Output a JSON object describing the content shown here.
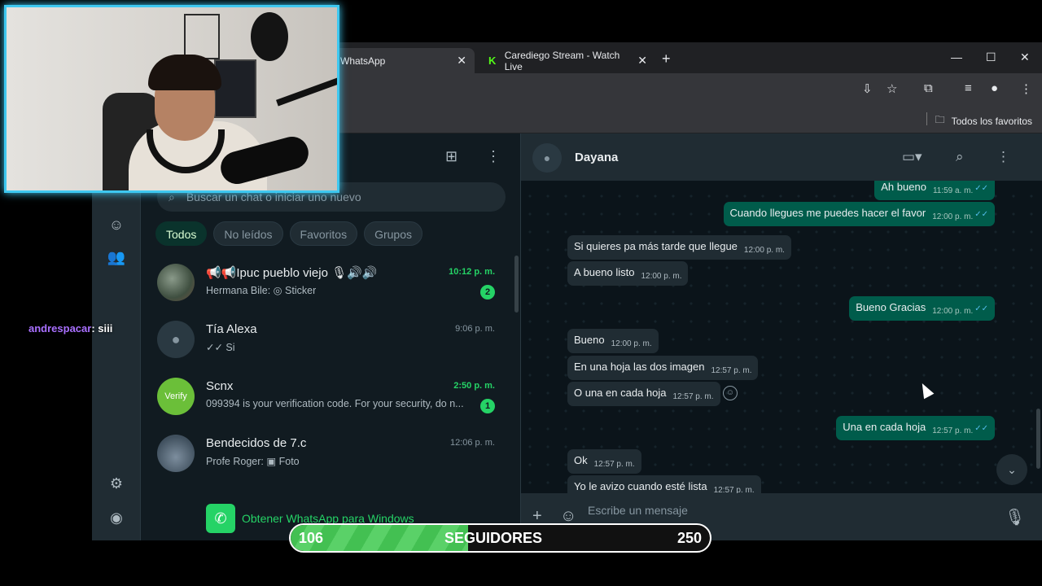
{
  "browser": {
    "tabs": [
      {
        "label": "WhatsApp",
        "active": true
      },
      {
        "label": "Carediego Stream - Watch Live",
        "active": false
      }
    ],
    "bookmarks_label": "Todos los favoritos"
  },
  "sidebar": {
    "search_placeholder": "Buscar un chat o iniciar uno nuevo",
    "filters": [
      "Todos",
      "No leídos",
      "Favoritos",
      "Grupos"
    ],
    "chats": [
      {
        "title": "📢📢Ipuc pueblo viejo 🎙🔊🔊",
        "subtitle": "Hermana Bile: ◎ Sticker",
        "time": "10:12 p. m.",
        "unread": "2"
      },
      {
        "title": "Tía Alexa",
        "subtitle": "✓✓ Si",
        "time": "9:06 p. m.",
        "unread": ""
      },
      {
        "title": "Scnx",
        "subtitle": "099394 is your verification code. For your security, do n...",
        "time": "2:50 p. m.",
        "unread": "1",
        "avatar_text": "Verify"
      },
      {
        "title": "Bendecidos de 7.c",
        "subtitle": "Profe Roger: ▣ Foto",
        "time": "12:06 p. m.",
        "unread": ""
      }
    ],
    "get_app": "Obtener WhatsApp para Windows"
  },
  "conversation": {
    "contact": "Dayana",
    "composer_placeholder": "Escribe un mensaje",
    "messages": [
      {
        "dir": "out",
        "text": "Ah bueno",
        "time": "11:59 a. m."
      },
      {
        "dir": "out",
        "text": "Cuando llegues me puedes hacer el favor",
        "time": "12:00 p. m."
      },
      {
        "dir": "in",
        "text": "Si quieres pa más tarde que llegue",
        "time": "12:00 p. m."
      },
      {
        "dir": "in",
        "text": "A bueno listo",
        "time": "12:00 p. m."
      },
      {
        "dir": "out",
        "text": "Bueno Gracias",
        "time": "12:00 p. m."
      },
      {
        "dir": "in",
        "text": "Bueno",
        "time": "12:00 p. m."
      },
      {
        "dir": "in",
        "text": "En una hoja las dos imagen",
        "time": "12:57 p. m."
      },
      {
        "dir": "in",
        "text": "O una en cada hoja",
        "time": "12:57 p. m."
      },
      {
        "dir": "out",
        "text": "Una en cada hoja",
        "time": "12:57 p. m."
      },
      {
        "dir": "in",
        "text": "Ok",
        "time": "12:57 p. m."
      },
      {
        "dir": "in",
        "text": "Yo le avizo cuando esté lista",
        "time": "12:57 p. m."
      }
    ]
  },
  "stream": {
    "chat_user": "andrespacar",
    "chat_message": ": siii",
    "followers_current": "106",
    "followers_label": "SEGUIDORES",
    "followers_goal": "250",
    "followers_progress": 0.424
  },
  "colors": {
    "accent_green": "#25d366",
    "bubble_out": "#005c4b",
    "bubble_in": "#202c33",
    "webcam_border": "#3ec8f0",
    "chat_user": "#a970ff"
  }
}
